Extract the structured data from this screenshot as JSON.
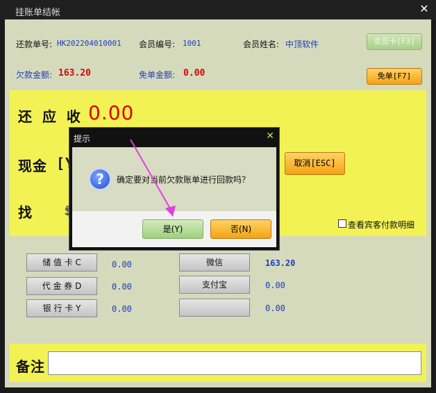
{
  "window": {
    "title": "挂账单结帐"
  },
  "header": {
    "repay_no_label": "还款单号:",
    "repay_no": "HK202204010001",
    "member_no_label": "会员编号:",
    "member_no": "1001",
    "member_name_label": "会员姓名:",
    "member_name": "中顶软件",
    "member_card_btn": "会员卡[F3]",
    "owed_label": "欠款金额:",
    "owed": "163.20",
    "waived_label": "免单金额:",
    "waived": "0.00",
    "waive_btn": "免单[F7]"
  },
  "summary": {
    "receivable_label": "还 应 收",
    "receivable_value": "0.00",
    "cash_label": "现金",
    "cash_partial": "[Y",
    "change_label": "找",
    "change_partial": "零",
    "cancel_btn": "取消[ESC]",
    "guest_detail_label": "查看宾客付款明细"
  },
  "payments": [
    {
      "label": "储 值 卡 C",
      "value": "0.00"
    },
    {
      "label": "代 金 券 D",
      "value": "0.00"
    },
    {
      "label": "银 行 卡 Y",
      "value": "0.00"
    },
    {
      "label": "微信",
      "value": "163.20"
    },
    {
      "label": "支付宝",
      "value": "0.00"
    },
    {
      "label": "",
      "value": "0.00"
    }
  ],
  "remark": {
    "label": "备注"
  },
  "dialog": {
    "title": "提示",
    "message": "确定要对当前欠款账单进行回款吗？",
    "yes": "是(Y)",
    "no": "否(N)"
  },
  "colors": {
    "accent_orange": "#f4a313",
    "panel_yellow": "#f2f255",
    "client_bg": "#d6dabd",
    "arrow": "#e040e0"
  }
}
